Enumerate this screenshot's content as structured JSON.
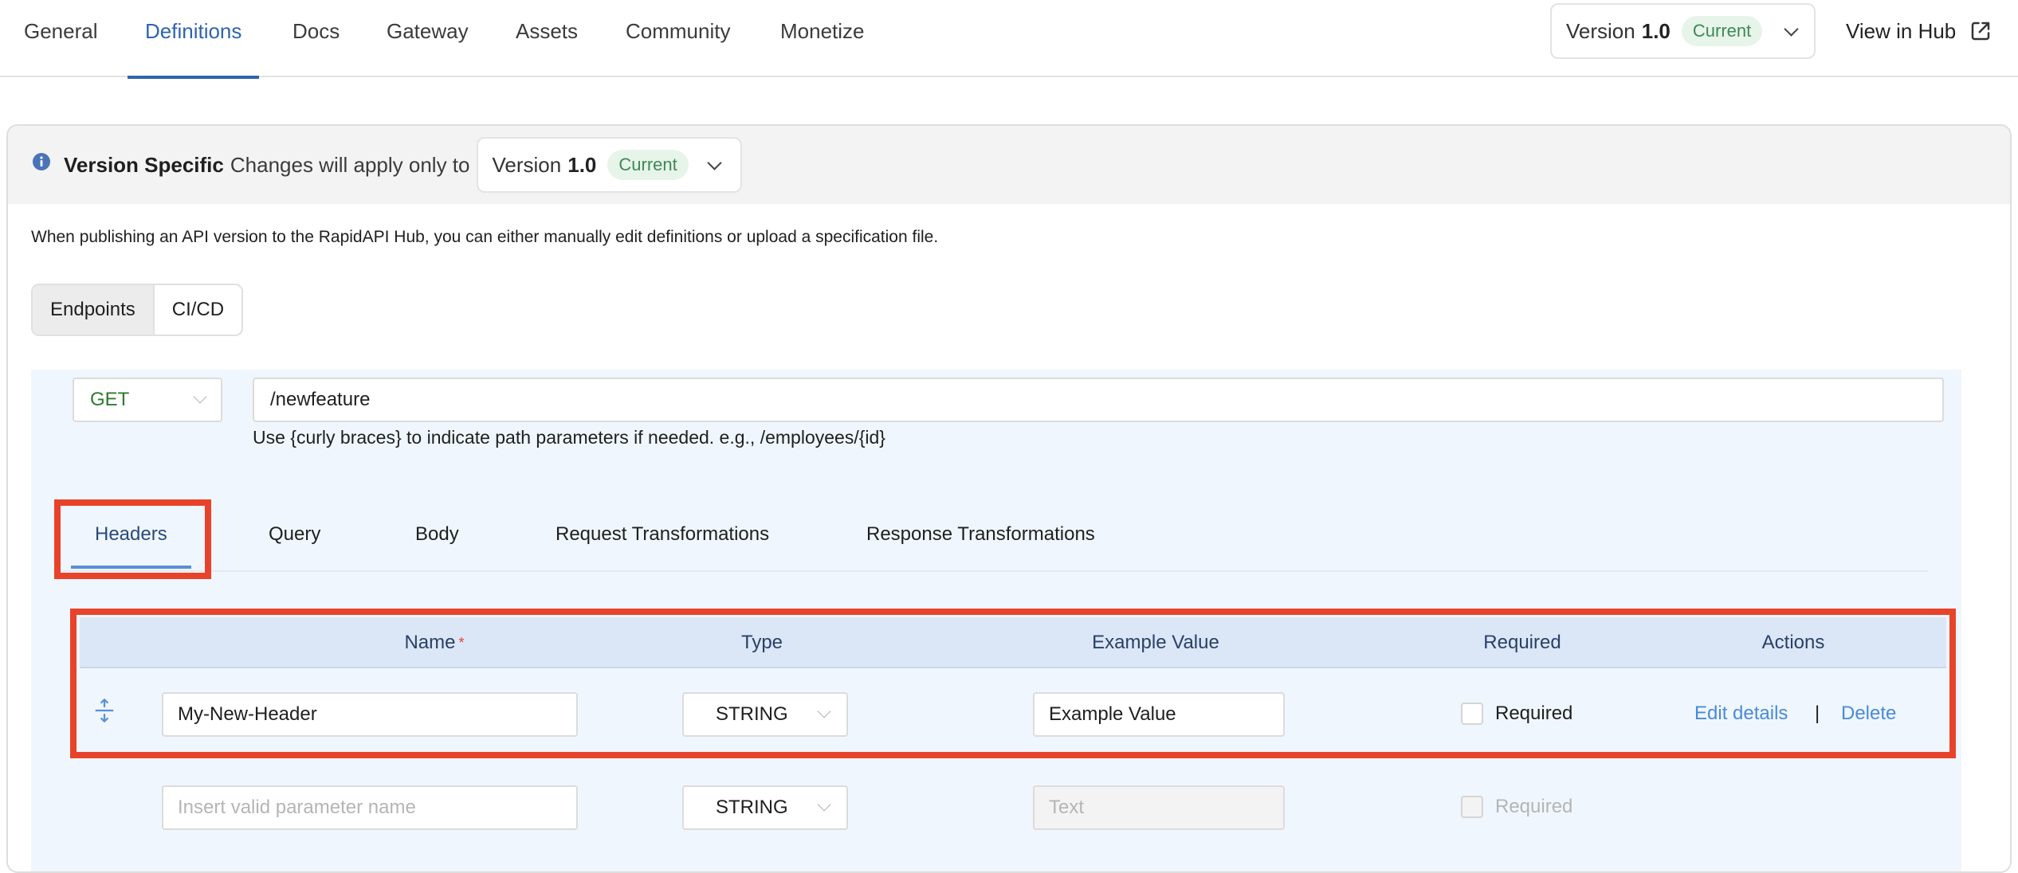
{
  "topnav": {
    "tabs": [
      {
        "label": "General",
        "active": false
      },
      {
        "label": "Definitions",
        "active": true
      },
      {
        "label": "Docs",
        "active": false
      },
      {
        "label": "Gateway",
        "active": false
      },
      {
        "label": "Assets",
        "active": false
      },
      {
        "label": "Community",
        "active": false
      },
      {
        "label": "Monetize",
        "active": false
      }
    ],
    "version": {
      "label": "Version",
      "number": "1.0",
      "badge": "Current"
    },
    "view_hub": "View in Hub"
  },
  "banner": {
    "title": "Version Specific",
    "text": "Changes will apply only to",
    "version": {
      "label": "Version",
      "number": "1.0",
      "badge": "Current"
    }
  },
  "description": "When publishing an API version to the RapidAPI Hub, you can either manually edit definitions or upload a specification file.",
  "segments": [
    {
      "label": "Endpoints",
      "active": true
    },
    {
      "label": "CI/CD",
      "active": false
    }
  ],
  "endpoint": {
    "method": "GET",
    "path": "/newfeature",
    "hint": "Use {curly braces} to indicate path parameters if needed. e.g., /employees/{id}"
  },
  "subtabs": [
    {
      "label": "Headers",
      "active": true
    },
    {
      "label": "Query",
      "active": false
    },
    {
      "label": "Body",
      "active": false
    },
    {
      "label": "Request Transformations",
      "active": false
    },
    {
      "label": "Response Transformations",
      "active": false
    }
  ],
  "table": {
    "columns": [
      "Name",
      "Type",
      "Example Value",
      "Required",
      "Actions"
    ],
    "name_required_marker": "*",
    "rows": [
      {
        "name": "My-New-Header",
        "type": "STRING",
        "example_value": "Example Value",
        "required_label": "Required",
        "required": false,
        "actions": {
          "edit": "Edit details",
          "separator": "|",
          "delete": "Delete"
        }
      }
    ],
    "new_row": {
      "name_placeholder": "Insert valid parameter name",
      "type": "STRING",
      "example_placeholder": "Text",
      "required_label": "Required",
      "required": false
    }
  },
  "colors": {
    "accent": "#2f63b0",
    "highlight": "#e8432a",
    "badge_bg": "#e7f4ea",
    "badge_text": "#3d8a55",
    "method_get": "#2f7a2f",
    "link": "#4a8ad8",
    "panel_bg": "#eff6fd",
    "table_header_bg": "#dbe7f6"
  }
}
